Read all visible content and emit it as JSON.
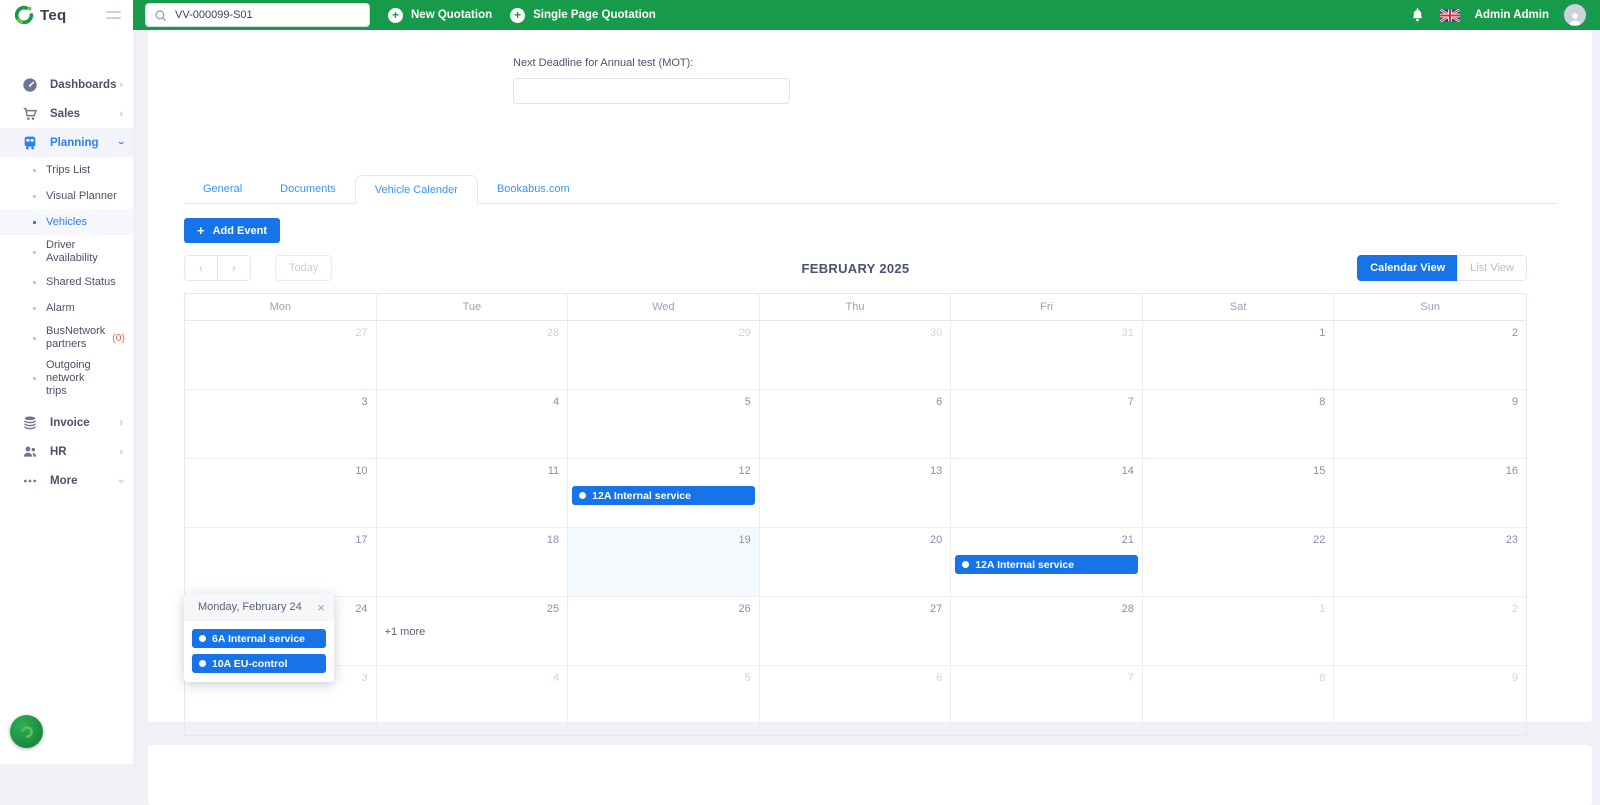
{
  "icons": {
    "plus": "+",
    "close": "×",
    "chevron": "›",
    "prev_arrow": "‹",
    "next_arrow": "›"
  },
  "topbar": {
    "logo_text": "Teq",
    "search": {
      "value": "VV-000099-S01"
    },
    "new_quotation": "New Quotation",
    "single_page_quotation": "Single Page Quotation",
    "user_name": "Admin Admin"
  },
  "sidebar": {
    "items": [
      {
        "label": "Dashboards"
      },
      {
        "label": "Sales"
      },
      {
        "label": "Planning",
        "children": [
          {
            "label": "Trips List"
          },
          {
            "label": "Visual Planner"
          },
          {
            "label": "Vehicles"
          },
          {
            "label": "Driver Availability"
          },
          {
            "label": "Shared Status"
          },
          {
            "label": "Alarm"
          },
          {
            "label": "BusNetwork partners",
            "badge": "(0)"
          },
          {
            "label": "Outgoing network trips"
          }
        ]
      },
      {
        "label": "Invoice"
      },
      {
        "label": "HR"
      },
      {
        "label": "More"
      }
    ]
  },
  "form": {
    "mot_label": "Next Deadline for Annual test (MOT):",
    "mot_value": ""
  },
  "tabs": {
    "items": [
      {
        "label": "General"
      },
      {
        "label": "Documents"
      },
      {
        "label": "Vehicle Calender"
      },
      {
        "label": "Bookabus.com"
      }
    ]
  },
  "calendar": {
    "add_event_label": "Add Event",
    "today_label": "Today",
    "title": "FEBRUARY 2025",
    "view_calendar": "Calendar View",
    "view_list": "List View",
    "day_headers": [
      "Mon",
      "Tue",
      "Wed",
      "Thu",
      "Fri",
      "Sat",
      "Sun"
    ],
    "weeks": [
      [
        {
          "d": "27",
          "muted": true
        },
        {
          "d": "28",
          "muted": true
        },
        {
          "d": "29",
          "muted": true
        },
        {
          "d": "30",
          "muted": true
        },
        {
          "d": "31",
          "muted": true
        },
        {
          "d": "1"
        },
        {
          "d": "2"
        }
      ],
      [
        {
          "d": "3"
        },
        {
          "d": "4"
        },
        {
          "d": "5"
        },
        {
          "d": "6"
        },
        {
          "d": "7"
        },
        {
          "d": "8"
        },
        {
          "d": "9"
        }
      ],
      [
        {
          "d": "10"
        },
        {
          "d": "11"
        },
        {
          "d": "12",
          "events": [
            "12A Internal service"
          ]
        },
        {
          "d": "13"
        },
        {
          "d": "14"
        },
        {
          "d": "15"
        },
        {
          "d": "16"
        }
      ],
      [
        {
          "d": "17"
        },
        {
          "d": "18"
        },
        {
          "d": "19",
          "today": true
        },
        {
          "d": "20"
        },
        {
          "d": "21",
          "events": [
            "12A Internal service"
          ]
        },
        {
          "d": "22"
        },
        {
          "d": "23"
        }
      ],
      [
        {
          "d": "24"
        },
        {
          "d": "25",
          "more": "+1 more"
        },
        {
          "d": "26"
        },
        {
          "d": "27"
        },
        {
          "d": "28"
        },
        {
          "d": "1",
          "muted": true
        },
        {
          "d": "2",
          "muted": true
        }
      ],
      [
        {
          "d": "3",
          "muted": true
        },
        {
          "d": "4",
          "muted": true
        },
        {
          "d": "5",
          "muted": true
        },
        {
          "d": "6",
          "muted": true
        },
        {
          "d": "7",
          "muted": true
        },
        {
          "d": "8",
          "muted": true
        },
        {
          "d": "9",
          "muted": true
        }
      ]
    ]
  },
  "popup": {
    "title": "Monday, February 24",
    "events": [
      "6A Internal service",
      "10A EU-control"
    ]
  },
  "colors": {
    "green": "#179b4a",
    "blue": "#1673e8",
    "tab_blue": "#3d94f6",
    "red": "#f0654f"
  }
}
